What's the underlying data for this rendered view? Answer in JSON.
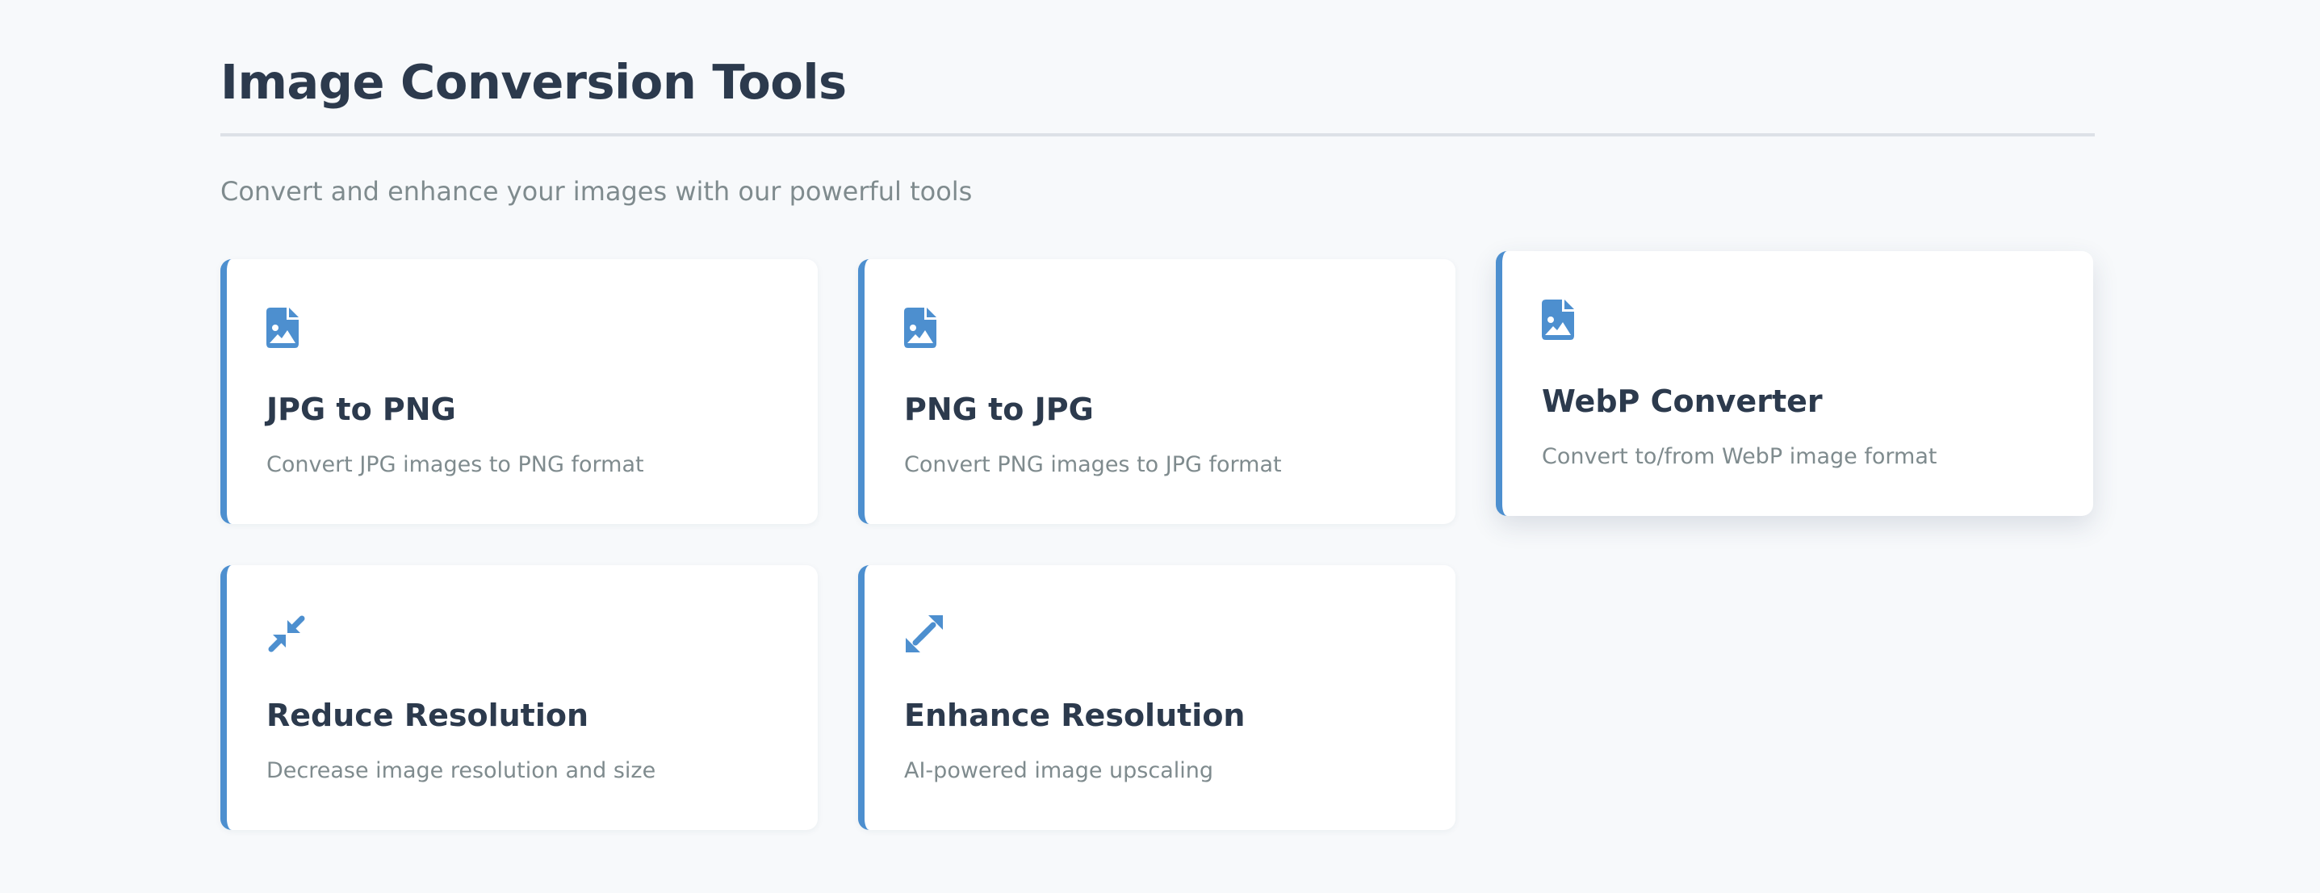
{
  "page": {
    "title": "Image Conversion Tools",
    "subtitle": "Convert and enhance your images with our powerful tools"
  },
  "colors": {
    "accent": "#4d8fcf",
    "heading": "#2c3a4d",
    "muted": "#7f8b8e",
    "background": "#f7f9fb",
    "card": "#ffffff"
  },
  "tools": [
    {
      "title": "JPG to PNG",
      "description": "Convert JPG images to PNG format",
      "icon": "file-image-icon"
    },
    {
      "title": "PNG to JPG",
      "description": "Convert PNG images to JPG format",
      "icon": "file-image-icon"
    },
    {
      "title": "WebP Converter",
      "description": "Convert to/from WebP image format",
      "icon": "file-image-icon"
    },
    {
      "title": "Reduce Resolution",
      "description": "Decrease image resolution and size",
      "icon": "compress-arrows-icon"
    },
    {
      "title": "Enhance Resolution",
      "description": "AI-powered image upscaling",
      "icon": "expand-arrows-icon"
    }
  ]
}
